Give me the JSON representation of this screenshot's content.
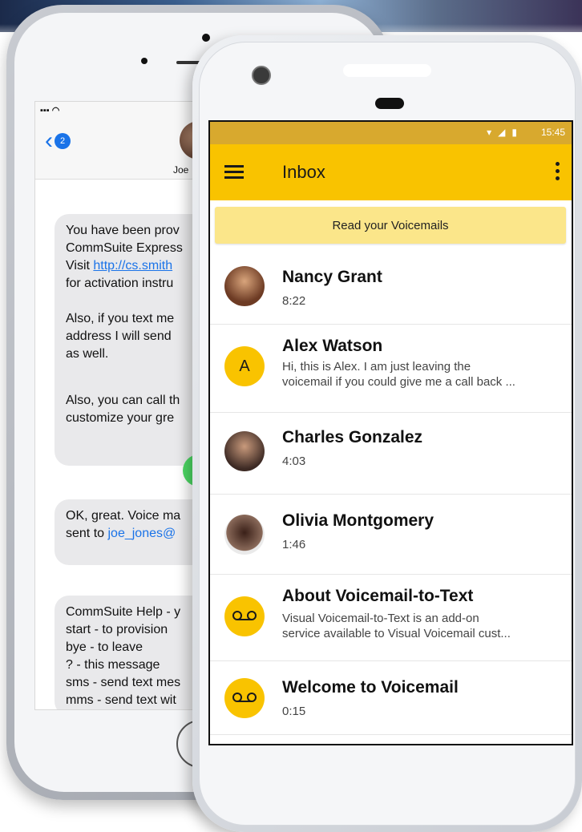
{
  "iphone": {
    "back_count": "2",
    "contact_name": "Joe",
    "messages": [
      {
        "pre": "You have been prov\nCommSuite Express\nVisit ",
        "link": "http://cs.smith",
        "post": "\nfor activation instru\n\nAlso, if you text me\naddress I will send \nas well."
      },
      {
        "text": "Also, you can call th\ncustomize your gre"
      },
      {
        "pre": "OK, great. Voice ma\nsent to ",
        "blue": "joe_jones@"
      },
      {
        "text": "CommSuite Help - y\nstart - to provision\nbye - to leave\n? - this message\nsms - send text mes\nmms - send text wit"
      }
    ]
  },
  "android": {
    "status_time": "15:45",
    "app_title": "Inbox",
    "banner": "Read your Voicemails",
    "items": [
      {
        "name": "Nancy Grant",
        "sub": "8:22"
      },
      {
        "name": "Alex Watson",
        "initial": "A",
        "sub": "Hi, this is Alex. I am just leaving the\nvoicemail if you could give me a call back ..."
      },
      {
        "name": "Charles Gonzalez",
        "sub": "4:03"
      },
      {
        "name": "Olivia Montgomery",
        "sub": "1:46"
      },
      {
        "name": "About Voicemail-to-Text",
        "sub": "Visual Voicemail-to-Text is an add-on\nservice available to Visual Voicemail cust..."
      },
      {
        "name": "Welcome to Voicemail",
        "sub": "0:15"
      }
    ]
  },
  "colors": {
    "accent_yellow": "#f9c300",
    "status_bar": "#d8a92e",
    "banner": "#fbe68a",
    "ios_link": "#1a73e8"
  }
}
